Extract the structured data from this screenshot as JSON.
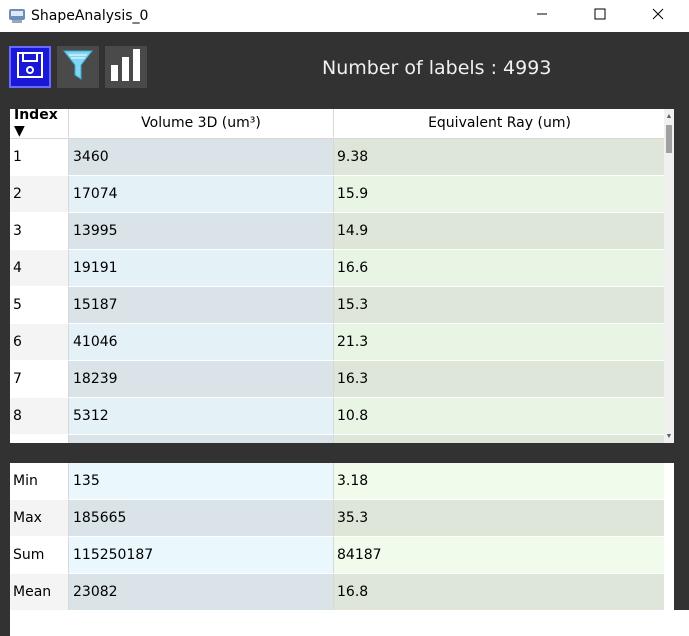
{
  "window": {
    "title": "ShapeAnalysis_0",
    "app_icon": "app-logo-icon",
    "controls": [
      "minimize-icon",
      "maximize-icon",
      "close-icon"
    ]
  },
  "toolbar": {
    "buttons": [
      "save-icon",
      "filter-icon",
      "bar-chart-icon"
    ],
    "label_count_text": "Number of labels : 4993"
  },
  "table": {
    "headers": {
      "index": "Index ▼",
      "volume": "Volume 3D (um³)",
      "ray": "Equivalent Ray (um)"
    },
    "rows": [
      {
        "index": "1",
        "volume": "3460",
        "ray": "9.38"
      },
      {
        "index": "2",
        "volume": "17074",
        "ray": "15.9"
      },
      {
        "index": "3",
        "volume": "13995",
        "ray": "14.9"
      },
      {
        "index": "4",
        "volume": "19191",
        "ray": "16.6"
      },
      {
        "index": "5",
        "volume": "15187",
        "ray": "15.3"
      },
      {
        "index": "6",
        "volume": "41046",
        "ray": "21.3"
      },
      {
        "index": "7",
        "volume": "18239",
        "ray": "16.3"
      },
      {
        "index": "8",
        "volume": "5312",
        "ray": "10.8"
      },
      {
        "index": "",
        "volume": "",
        "ray": ""
      }
    ]
  },
  "summary": {
    "rows": [
      {
        "label": "Min",
        "volume": "135",
        "ray": "3.18"
      },
      {
        "label": "Max",
        "volume": "185665",
        "ray": "35.3"
      },
      {
        "label": "Sum",
        "volume": "115250187",
        "ray": "84187"
      },
      {
        "label": "Mean",
        "volume": "23082",
        "ray": "16.8"
      }
    ]
  },
  "colors": {
    "background": "#323232",
    "save_button": "#1818d6",
    "volume_column": "#e4f1f7",
    "ray_column": "#e8f4e4"
  }
}
